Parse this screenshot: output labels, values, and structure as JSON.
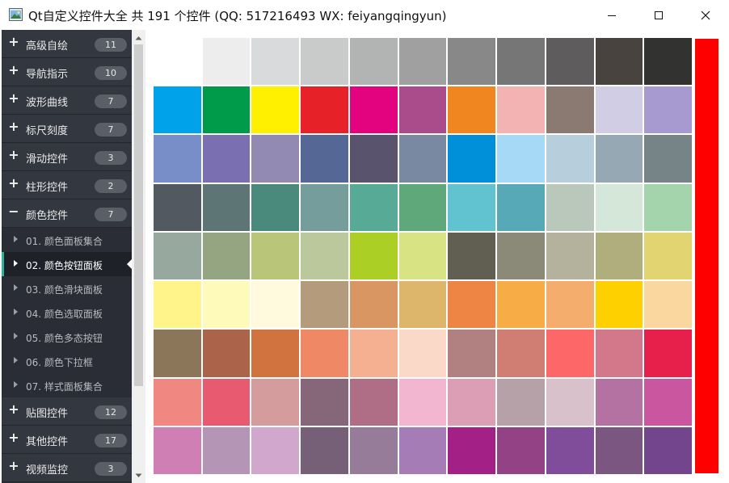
{
  "window": {
    "title": "Qt自定义控件大全 共 191 个控件 (QQ: 517216493 WX: feiyangqingyun)"
  },
  "sidebar": {
    "groups_before": [
      {
        "label": "高级自绘",
        "count": "11"
      },
      {
        "label": "导航指示",
        "count": "10"
      },
      {
        "label": "波形曲线",
        "count": "7"
      },
      {
        "label": "标尺刻度",
        "count": "7"
      },
      {
        "label": "滑动控件",
        "count": "3"
      },
      {
        "label": "柱形控件",
        "count": "2"
      }
    ],
    "expanded_group": {
      "label": "颜色控件",
      "count": "7"
    },
    "children": [
      {
        "label": "01. 颜色面板集合"
      },
      {
        "label": "02. 颜色按钮面板"
      },
      {
        "label": "03. 颜色滑块面板"
      },
      {
        "label": "04. 颜色选取面板"
      },
      {
        "label": "05. 颜色多态按钮"
      },
      {
        "label": "06. 颜色下拉框"
      },
      {
        "label": "07. 样式面板集合"
      }
    ],
    "groups_after": [
      {
        "label": "贴图控件",
        "count": "12"
      },
      {
        "label": "其他控件",
        "count": "17"
      },
      {
        "label": "视频监控",
        "count": "3"
      }
    ]
  },
  "color_panel": {
    "current_color": "#ff0000",
    "colors": [
      "#ffffff",
      "#ededed",
      "#d9dadb",
      "#c9cbcb",
      "#b2b3b3",
      "#a0a0a0",
      "#888888",
      "#767676",
      "#5e5c5d",
      "#48433f",
      "#323231",
      "#00a2e9",
      "#009b4a",
      "#fff000",
      "#e72128",
      "#e4037f",
      "#aa4b8c",
      "#ef8620",
      "#f3b3b3",
      "#8a7a72",
      "#d1cde4",
      "#a69ad0",
      "#778ec9",
      "#7a6fb0",
      "#938ab4",
      "#556895",
      "#5a536e",
      "#7989a2",
      "#0090d9",
      "#a6d9f5",
      "#b7cfdc",
      "#95a8b3",
      "#768487",
      "#535961",
      "#5d7675",
      "#4a8a7d",
      "#759d9b",
      "#57aa95",
      "#5fa87a",
      "#60c3cf",
      "#57a9b8",
      "#bac8bb",
      "#d4e7d9",
      "#a4d4ab",
      "#97a89e",
      "#96a581",
      "#b9c67a",
      "#bac89c",
      "#abcf24",
      "#d8e383",
      "#605f51",
      "#8b8978",
      "#b4b19c",
      "#b1ae7d",
      "#e1d471",
      "#fef48a",
      "#fefaba",
      "#fffade",
      "#b39b7b",
      "#da9662",
      "#ddb56b",
      "#ef8545",
      "#f7ac46",
      "#f5ad6e",
      "#ffd000",
      "#fbd7a0",
      "#8b765a",
      "#ab6349",
      "#d1733f",
      "#ee8865",
      "#f5af91",
      "#fad9c8",
      "#b08180",
      "#d07d73",
      "#fe6767",
      "#d2788a",
      "#e71f4b",
      "#f08781",
      "#e85a6f",
      "#d59c9e",
      "#86677a",
      "#b06e86",
      "#f3b6d0",
      "#db9eb4",
      "#b7a1a8",
      "#d8c1cb",
      "#b472a2",
      "#cb56a0",
      "#d07fb4",
      "#b495b6",
      "#d2a7cd",
      "#766077",
      "#977c99",
      "#a57cb5",
      "#a32086",
      "#934286",
      "#7f4d9a",
      "#7a5680",
      "#72458c"
    ]
  }
}
